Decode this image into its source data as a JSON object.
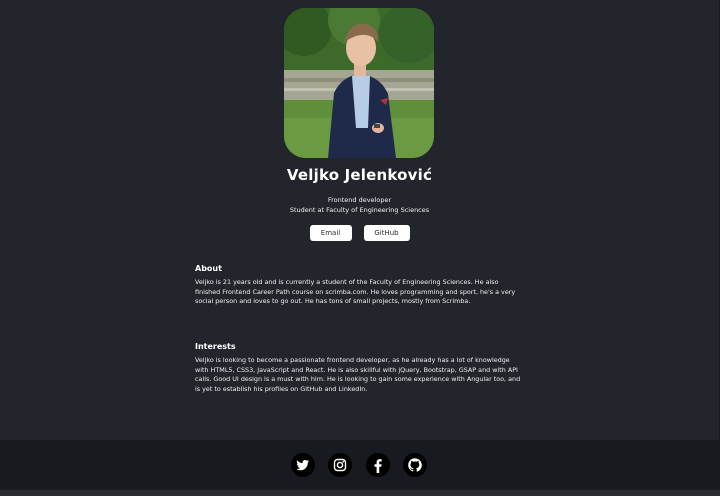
{
  "profile": {
    "name": "Veljko Jelenković",
    "role_line1": "Frontend developer",
    "role_line2": "Student at Faculty of Engineering Sciences"
  },
  "buttons": {
    "email": "Email",
    "github": "GitHub"
  },
  "about": {
    "heading": "About",
    "text": "Veljko is 21 years old and is currently a student of the Faculty of Engineering Sciences. He also finished Frontend Career Path course on scrimba.com. He loves programming and sport, he's a very social person and loves to go out. He has tons of small projects, mostly from Scrimba."
  },
  "interests": {
    "heading": "Interests",
    "text": "Veljko is looking to become a passionate frontend developer, as he already has a lot of knowledge with HTML5, CSS3, JavaScript and React. He is also skillful with jQuery, Bootstrap, GSAP and with API calls. Good UI design is a must with him. He is looking to gain some experience with Angular too, and is yet to establish his profiles on GitHub and LinkedIn."
  },
  "footer": {
    "icons": [
      "twitter-icon",
      "instagram-icon",
      "facebook-icon",
      "github-icon"
    ]
  },
  "colors": {
    "card_bg": "#23252c",
    "footer_bg": "#191a1f",
    "button_bg": "#ffffff",
    "text": "#ffffff"
  }
}
